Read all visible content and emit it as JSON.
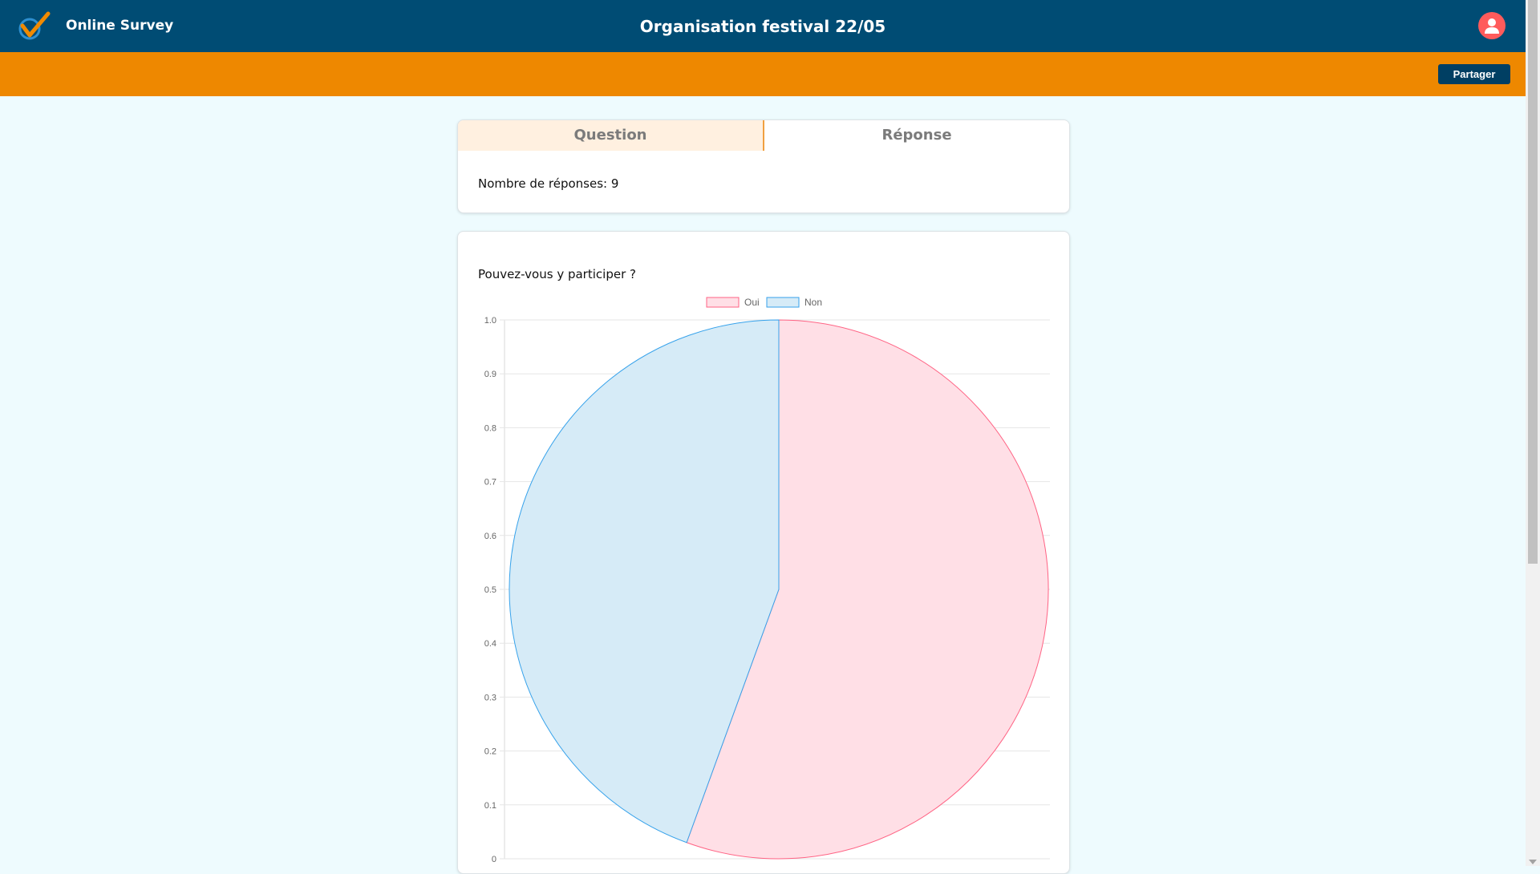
{
  "header": {
    "app_name": "Online Survey",
    "title": "Organisation festival 22/05"
  },
  "toolbar": {
    "share_label": "Partager"
  },
  "tabs": {
    "question_label": "Question",
    "response_label": "Réponse"
  },
  "summary": {
    "responses_text": "Nombre de réponses: 9"
  },
  "question": {
    "text": "Pouvez-vous y participer ?"
  },
  "colors": {
    "header": "#004c74",
    "subbar": "#ee8800",
    "share_button": "#003f63",
    "oui_fill": "#ffdfe6",
    "oui_stroke": "#ff6384",
    "non_fill": "#d6ebf7",
    "non_stroke": "#36a2eb",
    "avatar": "#ff5b5b"
  },
  "chart_data": {
    "type": "pie",
    "categories": [
      "Oui",
      "Non"
    ],
    "values": [
      5,
      4
    ],
    "legend": [
      "Oui",
      "Non"
    ],
    "legend_position": "top",
    "y_ticks": [
      "0",
      "0.1",
      "0.2",
      "0.3",
      "0.4",
      "0.5",
      "0.6",
      "0.7",
      "0.8",
      "0.9",
      "1.0"
    ],
    "ylim": [
      0,
      1
    ],
    "grid": true
  }
}
